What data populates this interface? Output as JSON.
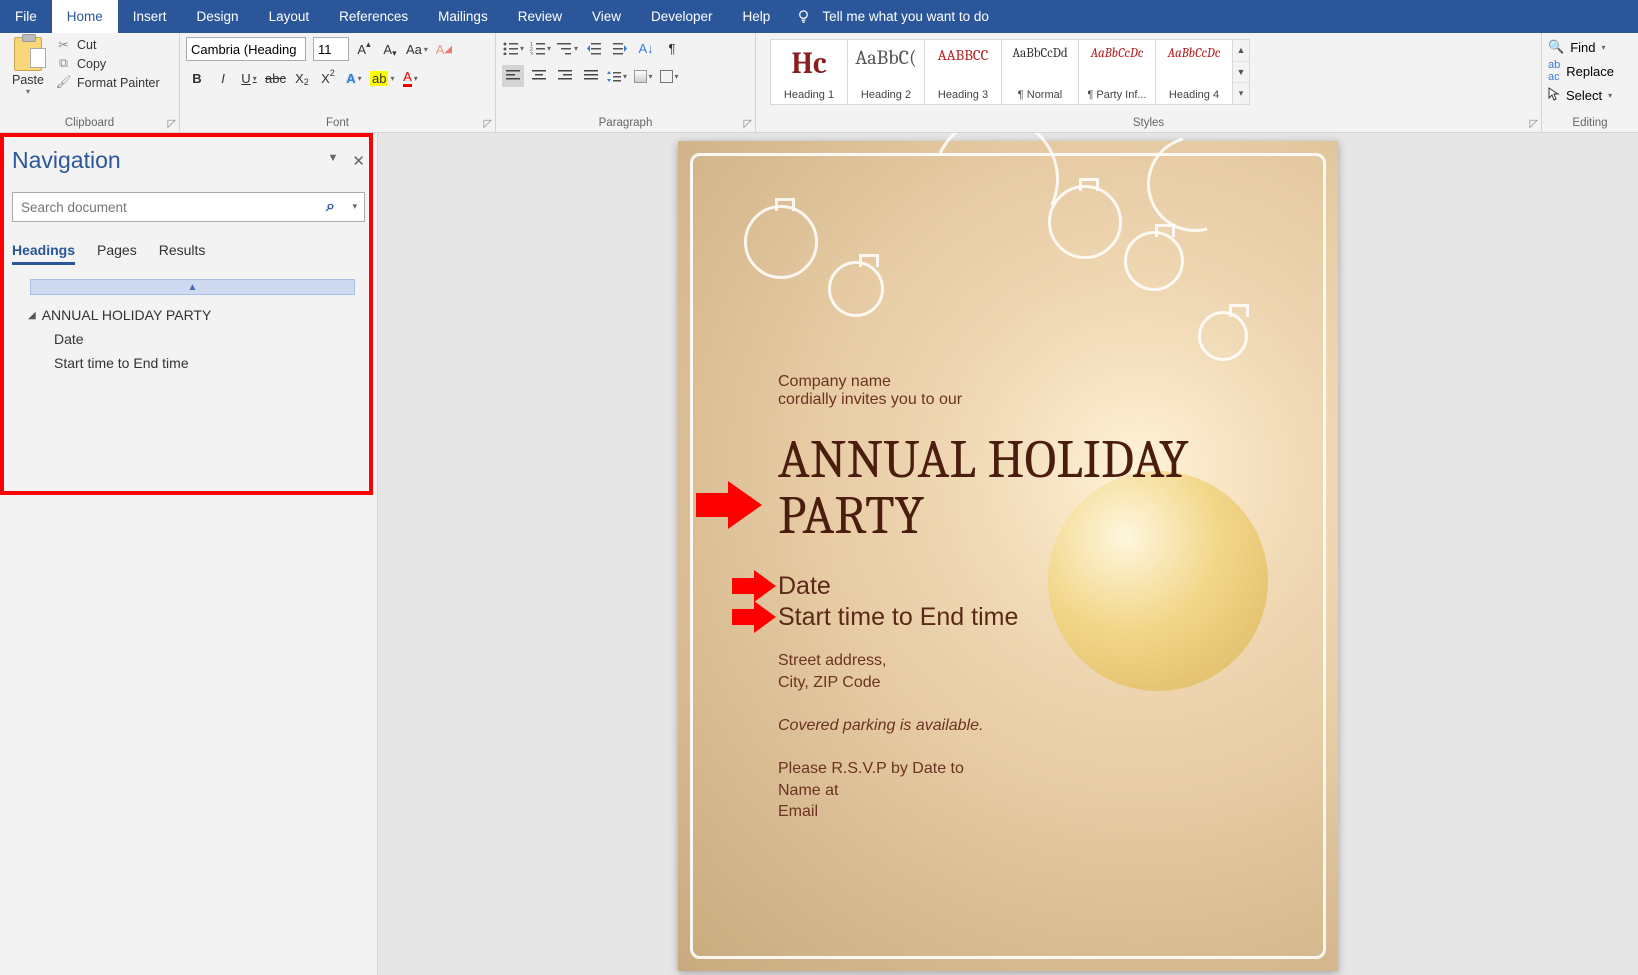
{
  "tabs": {
    "file": "File",
    "home": "Home",
    "insert": "Insert",
    "design": "Design",
    "layout": "Layout",
    "references": "References",
    "mailings": "Mailings",
    "review": "Review",
    "view": "View",
    "developer": "Developer",
    "help": "Help",
    "tell_me": "Tell me what you want to do"
  },
  "ribbon": {
    "clipboard": {
      "paste": "Paste",
      "cut": "Cut",
      "copy": "Copy",
      "format_painter": "Format Painter",
      "label": "Clipboard"
    },
    "font": {
      "name": "Cambria (Heading",
      "size": "11",
      "label": "Font"
    },
    "paragraph": {
      "label": "Paragraph"
    },
    "styles": {
      "label": "Styles",
      "items": [
        {
          "sample": "Hc",
          "sample_color": "#8a1d1d",
          "sample_size": "30px",
          "sample_weight": "bold",
          "name": "Heading 1"
        },
        {
          "sample": "AaBbC(",
          "sample_color": "#555",
          "sample_size": "20px",
          "name": "Heading 2"
        },
        {
          "sample": "AABBCC",
          "sample_color": "#b72020",
          "sample_size": "15px",
          "name": "Heading 3"
        },
        {
          "sample": "AaBbCcDd",
          "sample_color": "#333",
          "sample_size": "13px",
          "name": "¶ Normal"
        },
        {
          "sample": "AaBbCcDc",
          "sample_color": "#b72020",
          "sample_size": "13px",
          "sample_style": "italic",
          "name": "¶ Party Inf..."
        },
        {
          "sample": "AaBbCcDc",
          "sample_color": "#b72020",
          "sample_size": "13px",
          "sample_style": "italic",
          "name": "Heading 4"
        }
      ]
    },
    "editing": {
      "find": "Find",
      "replace": "Replace",
      "select": "Select",
      "label": "Editing"
    }
  },
  "navigation": {
    "title": "Navigation",
    "search_placeholder": "Search document",
    "tabs": {
      "headings": "Headings",
      "pages": "Pages",
      "results": "Results"
    },
    "tree": {
      "root": "ANNUAL HOLIDAY PARTY",
      "children": [
        "Date",
        "Start time to End time"
      ]
    }
  },
  "document": {
    "company": "Company name",
    "invites": "cordially invites you to our",
    "h1": "ANNUAL HOLIDAY PARTY",
    "h2a": "Date",
    "h2b": "Start time to End time",
    "addr1": "Street address,",
    "addr2": "City, ZIP Code",
    "parking": "Covered parking is available.",
    "rsvp1": "Please R.S.V.P by Date to",
    "rsvp2": "Name at",
    "rsvp3": "Email"
  }
}
